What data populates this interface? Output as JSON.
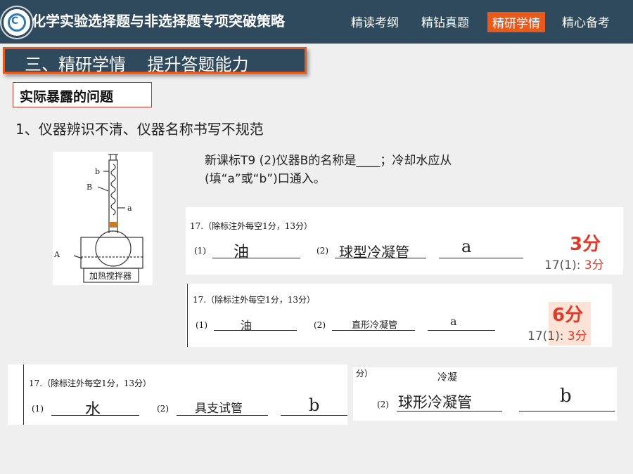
{
  "header": {
    "title": "化学实验选择题与非选择题专项突破策略",
    "logo_text": "C",
    "nav": [
      {
        "label": "精读考纲",
        "active": false
      },
      {
        "label": "精钻真题",
        "active": false
      },
      {
        "label": "精研学情",
        "active": true
      },
      {
        "label": "精心备考",
        "active": false
      }
    ]
  },
  "section_title": "三、精研学情    提升答题能力",
  "problem_label": "实际暴露的问题",
  "point_1": "1、仪器辨识不清、仪器名称书写不规范",
  "question": {
    "line1": "新课标T9 (2)仪器B的名称是____；冷却水应从",
    "line2": "(填“a”或“b”)口通入。"
  },
  "apparatus": {
    "label_b": "b",
    "label_B": "B",
    "label_a": "a",
    "label_A": "A",
    "caption": "加热搅拌器"
  },
  "answer_sheets": [
    {
      "header": "17.（除标注外每空1分，13分）",
      "blank1_label": "(1)",
      "blank1_answer": "油",
      "blank2_label": "(2)",
      "blank2_answer": "球型冷凝管",
      "blank3_answer": "a",
      "score": "3分",
      "sub_score_label": "17(1):",
      "sub_score_value": "3分"
    },
    {
      "header": "17.（除标注外每空1分，13分）",
      "blank1_label": "(1)",
      "blank1_answer": "油",
      "blank2_label": "(2)",
      "blank2_answer": "直形冷凝管",
      "blank3_answer": "a",
      "score": "6分",
      "sub_score_label": "17(1):",
      "sub_score_value": "3分"
    },
    {
      "header": "17.（除标注外每空1分，13分）",
      "blank1_label": "(1)",
      "blank1_answer": "水",
      "blank2_label": "(2)",
      "blank2_answer": "具支试管",
      "blank3_answer": "b"
    },
    {
      "header": "分）",
      "blank2_label": "(2)",
      "blank2_answer": "球形冷凝管",
      "blank2_annotation": "冷凝",
      "blank3_answer": "b"
    }
  ],
  "colors": {
    "header_bg": "#2f4a5c",
    "accent": "#e8591c",
    "score_red": "#e03a2a"
  }
}
